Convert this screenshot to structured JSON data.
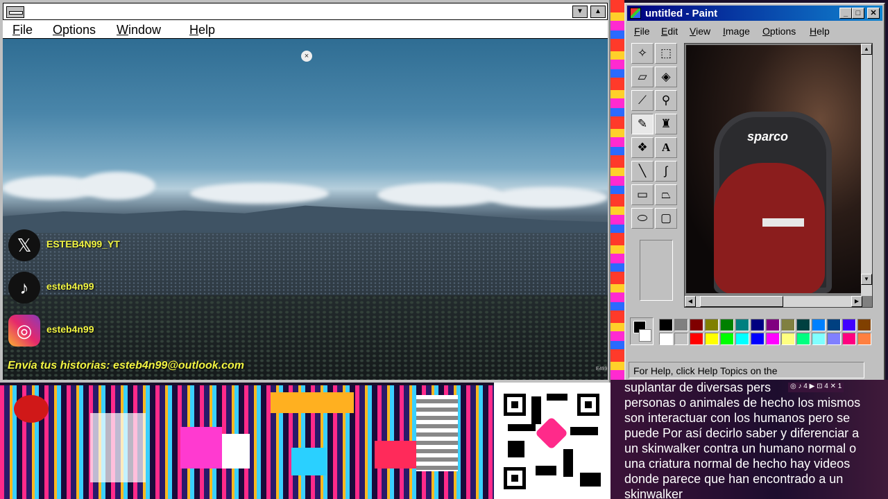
{
  "viewer": {
    "menu": [
      "File",
      "Options",
      "Window",
      "Help"
    ],
    "close_glyph": "×",
    "corner_tag": "E499"
  },
  "socials": [
    {
      "icon": "x-logo-icon",
      "glyph": "𝕏",
      "handle": "ESTEB4N99_YT"
    },
    {
      "icon": "tiktok-logo-icon",
      "glyph": "♪",
      "handle": "esteb4n99"
    },
    {
      "icon": "instagram-logo-icon",
      "glyph": "◎",
      "handle": "esteb4n99"
    }
  ],
  "stories_text": "Envía tus historias: esteb4n99@outlook.com",
  "paint": {
    "title": "untitled - Paint",
    "menu": [
      "File",
      "Edit",
      "View",
      "Image",
      "Options",
      "Help"
    ],
    "status": "For Help, click Help Topics on the",
    "canvas_brand": "sparco",
    "palette_top": [
      "#000000",
      "#808080",
      "#800000",
      "#808000",
      "#008000",
      "#008080",
      "#000080",
      "#800080",
      "#808040",
      "#004040",
      "#0080ff",
      "#004080",
      "#4000ff",
      "#804000"
    ],
    "palette_bottom": [
      "#ffffff",
      "#c0c0c0",
      "#ff0000",
      "#ffff00",
      "#00ff00",
      "#00ffff",
      "#0000ff",
      "#ff00ff",
      "#ffff80",
      "#00ff80",
      "#80ffff",
      "#8080ff",
      "#ff0080",
      "#ff8040"
    ],
    "tools": [
      "free-select",
      "rect-select",
      "eraser",
      "fill",
      "color-picker",
      "magnifier",
      "pencil",
      "brush",
      "airbrush",
      "text",
      "line",
      "curve",
      "rectangle",
      "polygon",
      "ellipse",
      "rounded-rect"
    ]
  },
  "caption": {
    "lines": [
      "suplantar de diversas pers",
      "personas o animales de hecho los mismos",
      "son interactuar con los humanos pero se",
      "puede Por así decirlo saber y diferenciar a",
      "un skinwalker contra un humano normal o",
      "una criatura normal de hecho hay videos",
      "donde parece que han encontrado a un",
      "skinwalker"
    ]
  },
  "mini_socials_text": "◎ ♪ 4 ▶ ⊡ 4 ✕ 1"
}
